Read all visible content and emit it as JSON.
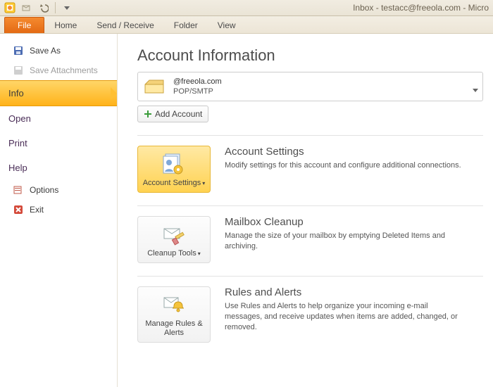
{
  "titlebar": {
    "title": "Inbox - testacc@freeola.com - Micro"
  },
  "ribbon": {
    "file": "File",
    "tabs": [
      "Home",
      "Send / Receive",
      "Folder",
      "View"
    ]
  },
  "nav": {
    "save_as": "Save As",
    "save_attachments": "Save Attachments",
    "info": "Info",
    "open": "Open",
    "print": "Print",
    "help": "Help",
    "options": "Options",
    "exit": "Exit"
  },
  "content": {
    "heading": "Account Information",
    "account_email": "@freeola.com",
    "account_type": "POP/SMTP",
    "add_account": "Add Account",
    "sections": [
      {
        "btn": "Account Settings",
        "title": "Account Settings",
        "desc": "Modify settings for this account and configure additional connections.",
        "has_dd": true,
        "sel": true
      },
      {
        "btn": "Cleanup Tools",
        "title": "Mailbox Cleanup",
        "desc": "Manage the size of your mailbox by emptying Deleted Items and archiving.",
        "has_dd": true,
        "sel": false
      },
      {
        "btn": "Manage Rules & Alerts",
        "title": "Rules and Alerts",
        "desc": "Use Rules and Alerts to help organize your incoming e-mail messages, and receive updates when items are added, changed, or removed.",
        "has_dd": false,
        "sel": false
      }
    ]
  }
}
